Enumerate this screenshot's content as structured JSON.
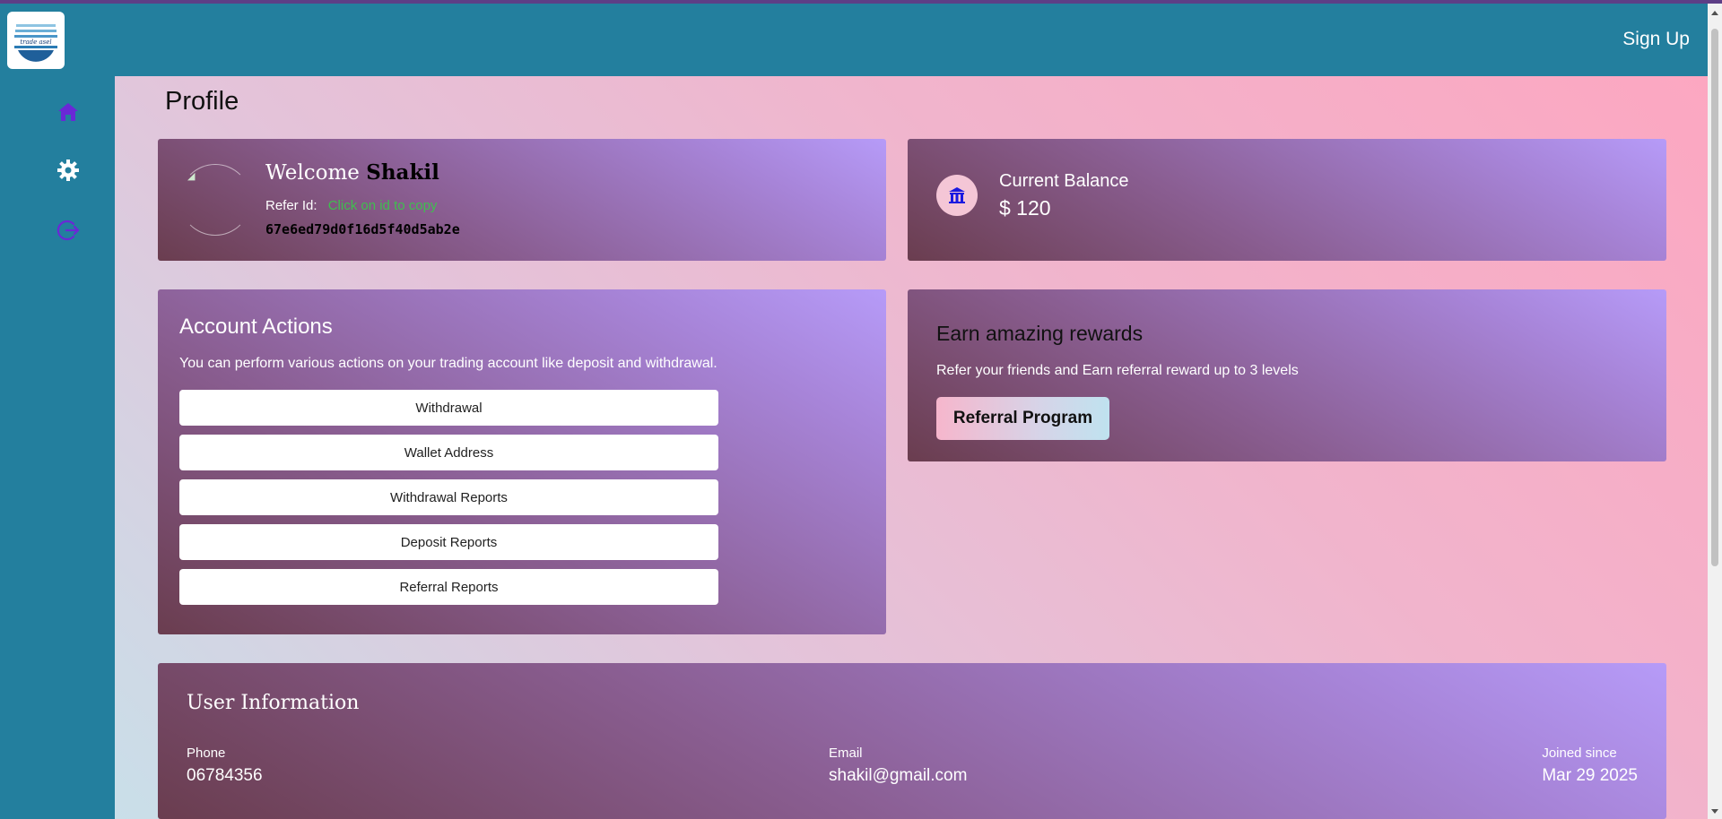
{
  "header": {
    "logo_text": "trade asel",
    "signup_label": "Sign Up"
  },
  "sidebar": {
    "items": [
      {
        "icon": "home-icon",
        "color": "#6a28d6"
      },
      {
        "icon": "gear-icon",
        "color": "#ffffff"
      },
      {
        "icon": "logout-icon",
        "color": "#6a28d6"
      }
    ]
  },
  "page": {
    "title": "Profile"
  },
  "welcome": {
    "greeting": "Welcome",
    "name": "Shakil",
    "refer_label": "Refer Id:",
    "refer_hint": "Click on id to copy",
    "refer_id": "67e6ed79d0f16d5f40d5ab2e"
  },
  "balance": {
    "icon": "bank-icon",
    "label": "Current Balance",
    "value": "$ 120"
  },
  "actions": {
    "title": "Account Actions",
    "description": "You can perform various actions on your trading account like deposit and withdrawal.",
    "buttons": [
      "Withdrawal",
      "Wallet Address",
      "Withdrawal Reports",
      "Deposit Reports",
      "Referral Reports"
    ]
  },
  "rewards": {
    "title": "Earn amazing rewards",
    "description": "Refer your friends and Earn referral reward up to 3 levels",
    "button_label": "Referral Program"
  },
  "user_info": {
    "title": "User Information",
    "phone_label": "Phone",
    "phone_value": "06784356",
    "email_label": "Email",
    "email_value": "shakil@gmail.com",
    "joined_label": "Joined since",
    "joined_value": "Mar 29 2025"
  },
  "colors": {
    "header": "#237f9e",
    "accent_purple": "#6a28d6",
    "refer_hint": "#3fbf4f"
  }
}
